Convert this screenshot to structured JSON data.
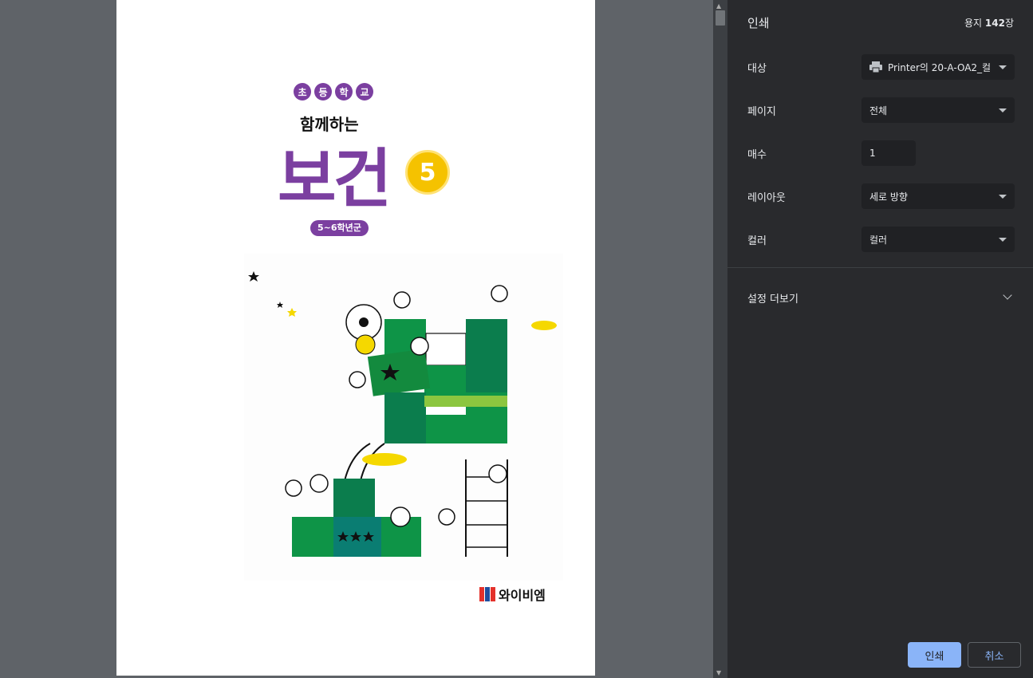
{
  "cover": {
    "school_chars": [
      "초",
      "등",
      "학",
      "교"
    ],
    "subtitle": "함께하는",
    "title": "보건",
    "volume": "5",
    "grade": "5~6학년군",
    "publisher": "와이비엠",
    "logo_text": "YBM"
  },
  "sidebar": {
    "title": "인쇄",
    "sheets_prefix": "용지 ",
    "sheets_count": "142",
    "sheets_suffix": "장",
    "destination_label": "대상",
    "destination_value": "Printer의 20-A-OA2_컬",
    "pages_label": "페이지",
    "pages_value": "전체",
    "copies_label": "매수",
    "copies_value": "1",
    "layout_label": "레이아웃",
    "layout_value": "세로 방향",
    "color_label": "컬러",
    "color_value": "컬러",
    "more_settings": "설정 더보기",
    "print_button": "인쇄",
    "cancel_button": "취소"
  },
  "colors": {
    "accent": "#8ab4f8",
    "cover_purple": "#7b3fa0",
    "cover_yellow": "#f5c200",
    "puzzle_green": "#0e9447"
  },
  "icons": [
    "printer-icon",
    "chevron-down-icon",
    "dropdown-caret-icon"
  ]
}
